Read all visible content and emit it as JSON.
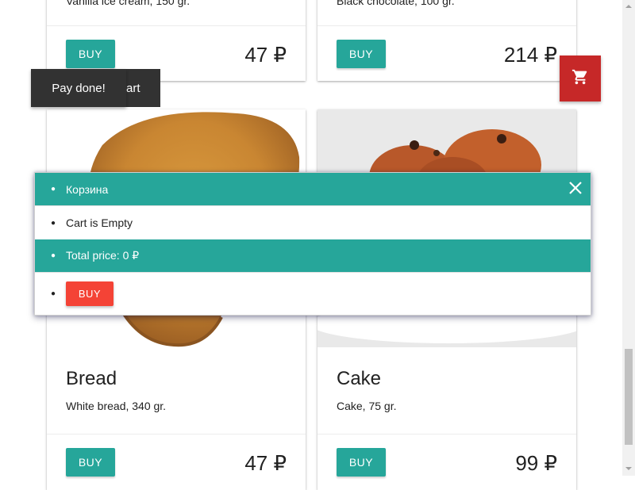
{
  "top_cards": [
    {
      "desc": "Vanilla ice cream, 150 gr.",
      "buy_label": "BUY",
      "price": "47 ₽"
    },
    {
      "desc": "Black chocolate, 100 gr.",
      "buy_label": "BUY",
      "price": "214 ₽"
    }
  ],
  "products": [
    {
      "title": "Bread",
      "desc": "White bread, 340 gr.",
      "buy_label": "BUY",
      "price": "47 ₽"
    },
    {
      "title": "Cake",
      "desc": "Cake, 75 gr.",
      "buy_label": "BUY",
      "price": "99 ₽"
    }
  ],
  "toast": {
    "text": "Pay done!",
    "partial_behind": "art"
  },
  "fab": {
    "icon": "shopping-cart-icon",
    "color": "#c62828"
  },
  "cart": {
    "title": "Корзина",
    "empty_text": "Cart is Empty",
    "total_text": "Total price: 0 ₽",
    "buy_label": "BUY",
    "close_icon": "close-icon"
  },
  "colors": {
    "teal": "#26a69a",
    "red": "#f44336",
    "fab_red": "#c62828",
    "toast": "#323232"
  }
}
